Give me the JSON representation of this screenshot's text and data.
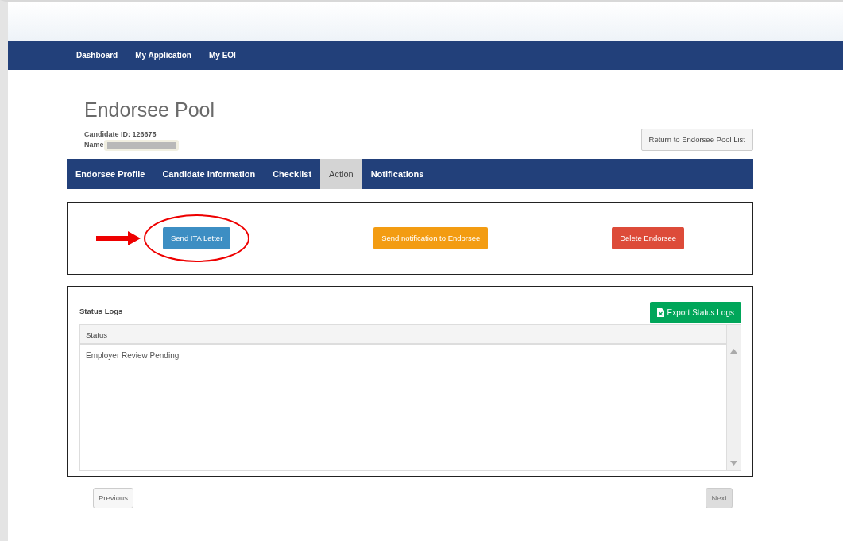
{
  "top_nav": [
    {
      "label": "Dashboard"
    },
    {
      "label": "My Application"
    },
    {
      "label": "My EOI"
    }
  ],
  "page_title": "Endorsee Pool",
  "candidate_id": "Candidate ID: 126675",
  "name_label": "Name",
  "return_button": "Return to Endorsee Pool List",
  "tabs": [
    {
      "label": "Endorsee Profile",
      "selected": false
    },
    {
      "label": "Candidate Information",
      "selected": false
    },
    {
      "label": "Checklist",
      "selected": false
    },
    {
      "label": "Action",
      "selected": true
    },
    {
      "label": "Notifications",
      "selected": false
    }
  ],
  "actions": [
    {
      "label": "Send ITA Letter",
      "kind": "info",
      "highlighted": true
    },
    {
      "label": "Send notification to Endorsee",
      "kind": "warning",
      "highlighted": false
    },
    {
      "label": "Delete Endorsee",
      "kind": "danger",
      "highlighted": false
    }
  ],
  "status_logs": {
    "title": "Status Logs",
    "export_button": "Export Status Logs",
    "columns": [
      "Status"
    ],
    "rows": [
      "Employer Review Pending"
    ]
  },
  "pagination": [
    {
      "label": "Previous",
      "disabled": false
    },
    {
      "label": "Next",
      "disabled": true
    }
  ]
}
